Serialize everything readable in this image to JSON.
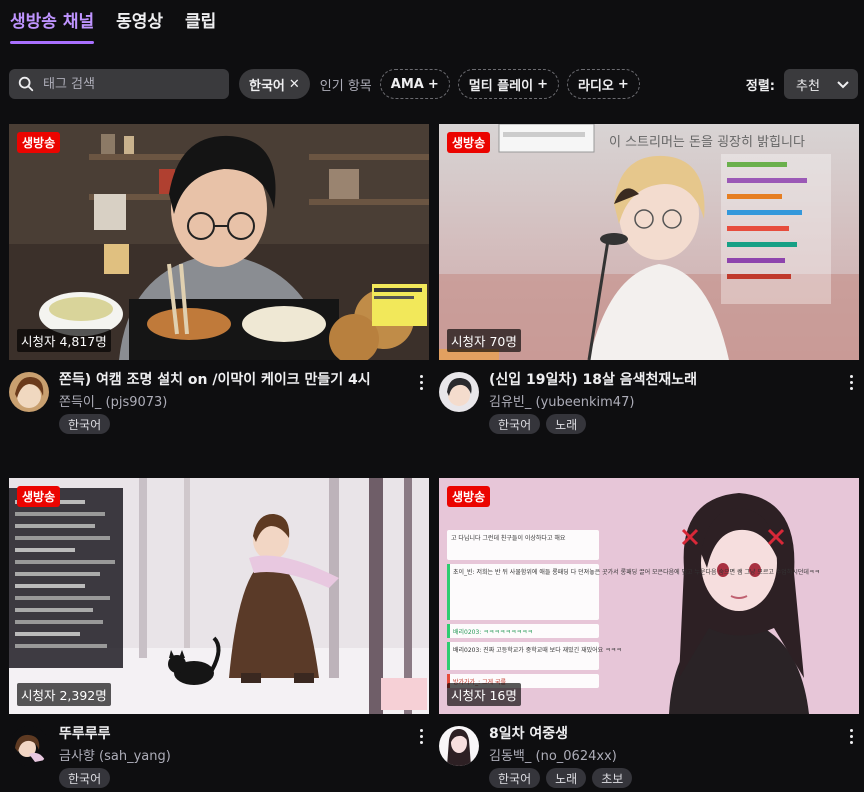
{
  "tabs": [
    {
      "label": "생방송 채널",
      "active": true
    },
    {
      "label": "동영상",
      "active": false
    },
    {
      "label": "클립",
      "active": false
    }
  ],
  "search": {
    "placeholder": "태그 검색"
  },
  "filters": {
    "selected_chip": "한국어",
    "popular_label": "인기 항목",
    "popular_chips": [
      "AMA",
      "멀티 플레이",
      "라디오"
    ]
  },
  "sort": {
    "label": "정렬:",
    "value": "추천"
  },
  "streams": [
    {
      "live_label": "생방송",
      "viewers": "시청자 4,817명",
      "title": "쫀득) 여캠 조명 설치 on /이막이 케이크 만들기 4시",
      "channel": "쫀득이_ (pjs9073)",
      "tags": [
        "한국어"
      ]
    },
    {
      "live_label": "생방송",
      "viewers": "시청자 70명",
      "title": "(신입 19일차) 18살 음색천재노래",
      "channel": "김유빈_ (yubeenkim47)",
      "tags": [
        "한국어",
        "노래"
      ],
      "overlay_text": "이 스트리머는 돈을 굉장히 밝힙니다"
    },
    {
      "live_label": "생방송",
      "viewers": "시청자 2,392명",
      "title": "뚜루루루",
      "channel": "금사향 (sah_yang)",
      "tags": [
        "한국어"
      ]
    },
    {
      "live_label": "생방송",
      "viewers": "시청자 16명",
      "title": "8일차 여중생",
      "channel": "김동백_ (no_0624xx)",
      "tags": [
        "한국어",
        "노래",
        "초보"
      ],
      "chat_lines": [
        "고 다닙니다 그런데 친구들이 이상하다고 해요",
        "초이_빈: 저희는 반 뒤 사물함위에 애들 롱패딩 다 던져놓은 곳가서 롱패딩 끌어 모은다음에 덮고 누운다음 숨으면 쌤 그냥 모르고 수업하시던데ㅋㅋ",
        "배리0203: ㅋㅋㅋㅋㅋㅋㅋㅋㅋ",
        "배리0203: 진짜 고등학교가 중학교때 보다 재밌긴 재밌어요 ㅋㅋㅋ",
        "방가가가_: 그게 국룰"
      ]
    }
  ],
  "colors": {
    "accent": "#bf94ff",
    "live": "#eb0400",
    "background": "#0e0e10",
    "chip": "#3a3a3d"
  }
}
